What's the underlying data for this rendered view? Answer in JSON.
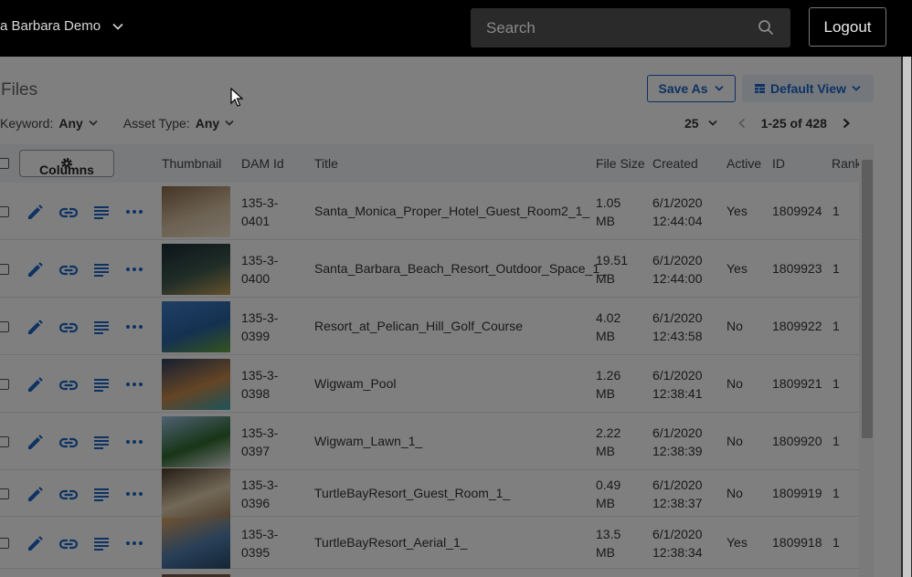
{
  "header": {
    "account_label": "a Barbara Demo",
    "search_placeholder": "Search",
    "logout_label": "Logout"
  },
  "toolbar": {
    "page_title": "Files",
    "save_as_label": "Save As",
    "default_view_label": "Default View",
    "filters": [
      {
        "label": "Keyword:",
        "value": "Any"
      },
      {
        "label": "Asset Type:",
        "value": "Any"
      }
    ],
    "page_size": "25",
    "range_label": "1-25 of 428"
  },
  "table": {
    "columns_button_label": "Columns",
    "headers": {
      "thumbnail": "Thumbnail",
      "dam_id": "DAM Id",
      "title": "Title",
      "file_size": "File Size",
      "created": "Created",
      "active": "Active",
      "id": "ID",
      "rank": "Rank"
    },
    "rows": [
      {
        "dam_a": "135-3-",
        "dam_b": "0401",
        "title": "Santa_Monica_Proper_Hotel_Guest_Room2_1_",
        "size_a": "1.05",
        "size_b": "MB",
        "date": "6/1/2020",
        "time": "12:44:04",
        "active": "Yes",
        "id": "1809924",
        "rank": "1",
        "thumb_colors": [
          "#8a6a4a",
          "#d9c3a4",
          "#f3e6d0"
        ]
      },
      {
        "dam_a": "135-3-",
        "dam_b": "0400",
        "title": "Santa_Barbara_Beach_Resort_Outdoor_Space_1_",
        "size_a": "19.51",
        "size_b": "MB",
        "date": "6/1/2020",
        "time": "12:44:00",
        "active": "Yes",
        "id": "1809923",
        "rank": "1",
        "thumb_colors": [
          "#1a2a35",
          "#3f5a4f",
          "#c9a25a"
        ]
      },
      {
        "dam_a": "135-3-",
        "dam_b": "0399",
        "title": "Resort_at_Pelican_Hill_Golf_Course",
        "size_a": "4.02",
        "size_b": "MB",
        "date": "6/1/2020",
        "time": "12:43:58",
        "active": "No",
        "id": "1809922",
        "rank": "1",
        "thumb_colors": [
          "#3e7ec9",
          "#2a63a3",
          "#6aa53c"
        ]
      },
      {
        "dam_a": "135-3-",
        "dam_b": "0398",
        "title": "Wigwam_Pool",
        "size_a": "1.26",
        "size_b": "MB",
        "date": "6/1/2020",
        "time": "12:38:41",
        "active": "No",
        "id": "1809921",
        "rank": "1",
        "thumb_colors": [
          "#2c3f63",
          "#c98a4a",
          "#3aa7b5"
        ]
      },
      {
        "dam_a": "135-3-",
        "dam_b": "0397",
        "title": "Wigwam_Lawn_1_",
        "size_a": "2.22",
        "size_b": "MB",
        "date": "6/1/2020",
        "time": "12:38:39",
        "active": "No",
        "id": "1809920",
        "rank": "1",
        "thumb_colors": [
          "#9fc3e8",
          "#2f6b2f",
          "#e6e6e6"
        ]
      },
      {
        "dam_a": "135-3-",
        "dam_b": "0396",
        "title": "TurtleBayResort_Guest_Room_1_",
        "size_a": "0.49",
        "size_b": "MB",
        "date": "6/1/2020",
        "time": "12:38:37",
        "active": "No",
        "id": "1809919",
        "rank": "1",
        "thumb_colors": [
          "#4a3a2a",
          "#e6d2b0",
          "#9a7a58"
        ]
      },
      {
        "dam_a": "135-3-",
        "dam_b": "0395",
        "title": "TurtleBayResort_Aerial_1_",
        "size_a": "13.5",
        "size_b": "MB",
        "date": "6/1/2020",
        "time": "12:38:34",
        "active": "Yes",
        "id": "1809918",
        "rank": "1",
        "thumb_colors": [
          "#e0a560",
          "#4f7fb0",
          "#2a4a6a"
        ]
      }
    ]
  },
  "colors": {
    "accent": "#1a64c6",
    "header_bg": "#000000"
  },
  "icons": {
    "row_actions": [
      "pencil-icon",
      "link-icon",
      "details-icon",
      "more-icon"
    ]
  }
}
